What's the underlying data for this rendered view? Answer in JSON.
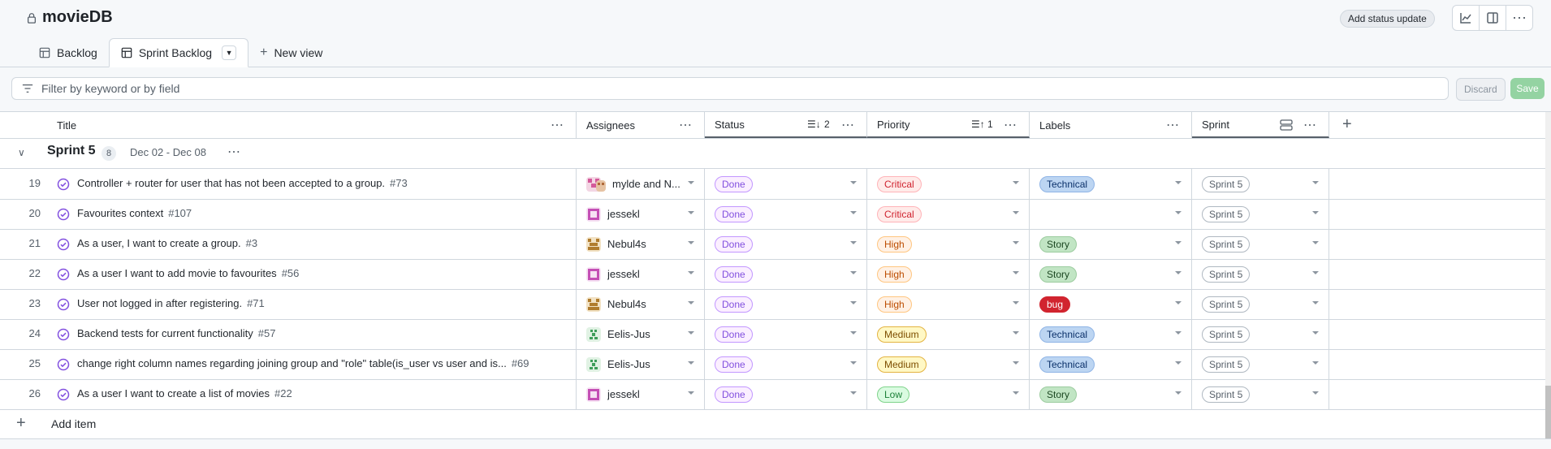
{
  "app": {
    "title": "movieDB",
    "status_update_label": "Add status update"
  },
  "tabs": [
    {
      "label": "Backlog",
      "active": false
    },
    {
      "label": "Sprint Backlog",
      "active": true
    },
    {
      "label": "New view",
      "active": false
    }
  ],
  "filter": {
    "placeholder": "Filter by keyword or by field",
    "discard_label": "Discard",
    "save_label": "Save"
  },
  "columns": {
    "title": "Title",
    "assignees": "Assignees",
    "status": "Status",
    "status_sort": "2",
    "priority": "Priority",
    "priority_sort": "1",
    "labels": "Labels",
    "sprint": "Sprint"
  },
  "group": {
    "name": "Sprint 5",
    "count": "8",
    "dates": "Dec 02 - Dec 08"
  },
  "rows": [
    {
      "num": "19",
      "title": "Controller + router for user that has not been accepted to a group.",
      "issue": "#73",
      "assignee": "mylde and N...",
      "avatar": "mylde",
      "status": "Done",
      "priority": "Critical",
      "priority_class": "critical",
      "label": "Technical",
      "label_class": "lbl-technical",
      "sprint": "Sprint 5"
    },
    {
      "num": "20",
      "title": "Favourites context",
      "issue": "#107",
      "assignee": "jessekl",
      "avatar": "jessekl",
      "status": "Done",
      "priority": "Critical",
      "priority_class": "critical",
      "label": "",
      "label_class": "",
      "sprint": "Sprint 5"
    },
    {
      "num": "21",
      "title": "As a user, I want to create a group.",
      "issue": "#3",
      "assignee": "Nebul4s",
      "avatar": "nebul4s",
      "status": "Done",
      "priority": "High",
      "priority_class": "high",
      "label": "Story",
      "label_class": "lbl-story",
      "sprint": "Sprint 5"
    },
    {
      "num": "22",
      "title": "As a user I want to add movie to favourites",
      "issue": "#56",
      "assignee": "jessekl",
      "avatar": "jessekl",
      "status": "Done",
      "priority": "High",
      "priority_class": "high",
      "label": "Story",
      "label_class": "lbl-story",
      "sprint": "Sprint 5"
    },
    {
      "num": "23",
      "title": "User not logged in after registering.",
      "issue": "#71",
      "assignee": "Nebul4s",
      "avatar": "nebul4s",
      "status": "Done",
      "priority": "High",
      "priority_class": "high",
      "label": "bug",
      "label_class": "lbl-bug",
      "sprint": "Sprint 5"
    },
    {
      "num": "24",
      "title": "Backend tests for current functionality",
      "issue": "#57",
      "assignee": "Eelis-Jus",
      "avatar": "eelis",
      "status": "Done",
      "priority": "Medium",
      "priority_class": "medium",
      "label": "Technical",
      "label_class": "lbl-technical",
      "sprint": "Sprint 5"
    },
    {
      "num": "25",
      "title": "change right column names regarding joining group and \"role\" table(is_user vs user and is...",
      "issue": "#69",
      "assignee": "Eelis-Jus",
      "avatar": "eelis",
      "status": "Done",
      "priority": "Medium",
      "priority_class": "medium",
      "label": "Technical",
      "label_class": "lbl-technical",
      "sprint": "Sprint 5"
    },
    {
      "num": "26",
      "title": "As a user I want to create a list of movies",
      "issue": "#22",
      "assignee": "jessekl",
      "avatar": "jessekl",
      "status": "Done",
      "priority": "Low",
      "priority_class": "low",
      "label": "Story",
      "label_class": "lbl-story",
      "sprint": "Sprint 5"
    }
  ],
  "add_item_label": "Add item",
  "colors": {
    "done": "#8250df",
    "critical": "#cf222e",
    "high": "#bc4c00",
    "medium": "#7d4e00",
    "low": "#1a7f37",
    "save": "#94d3a2"
  }
}
